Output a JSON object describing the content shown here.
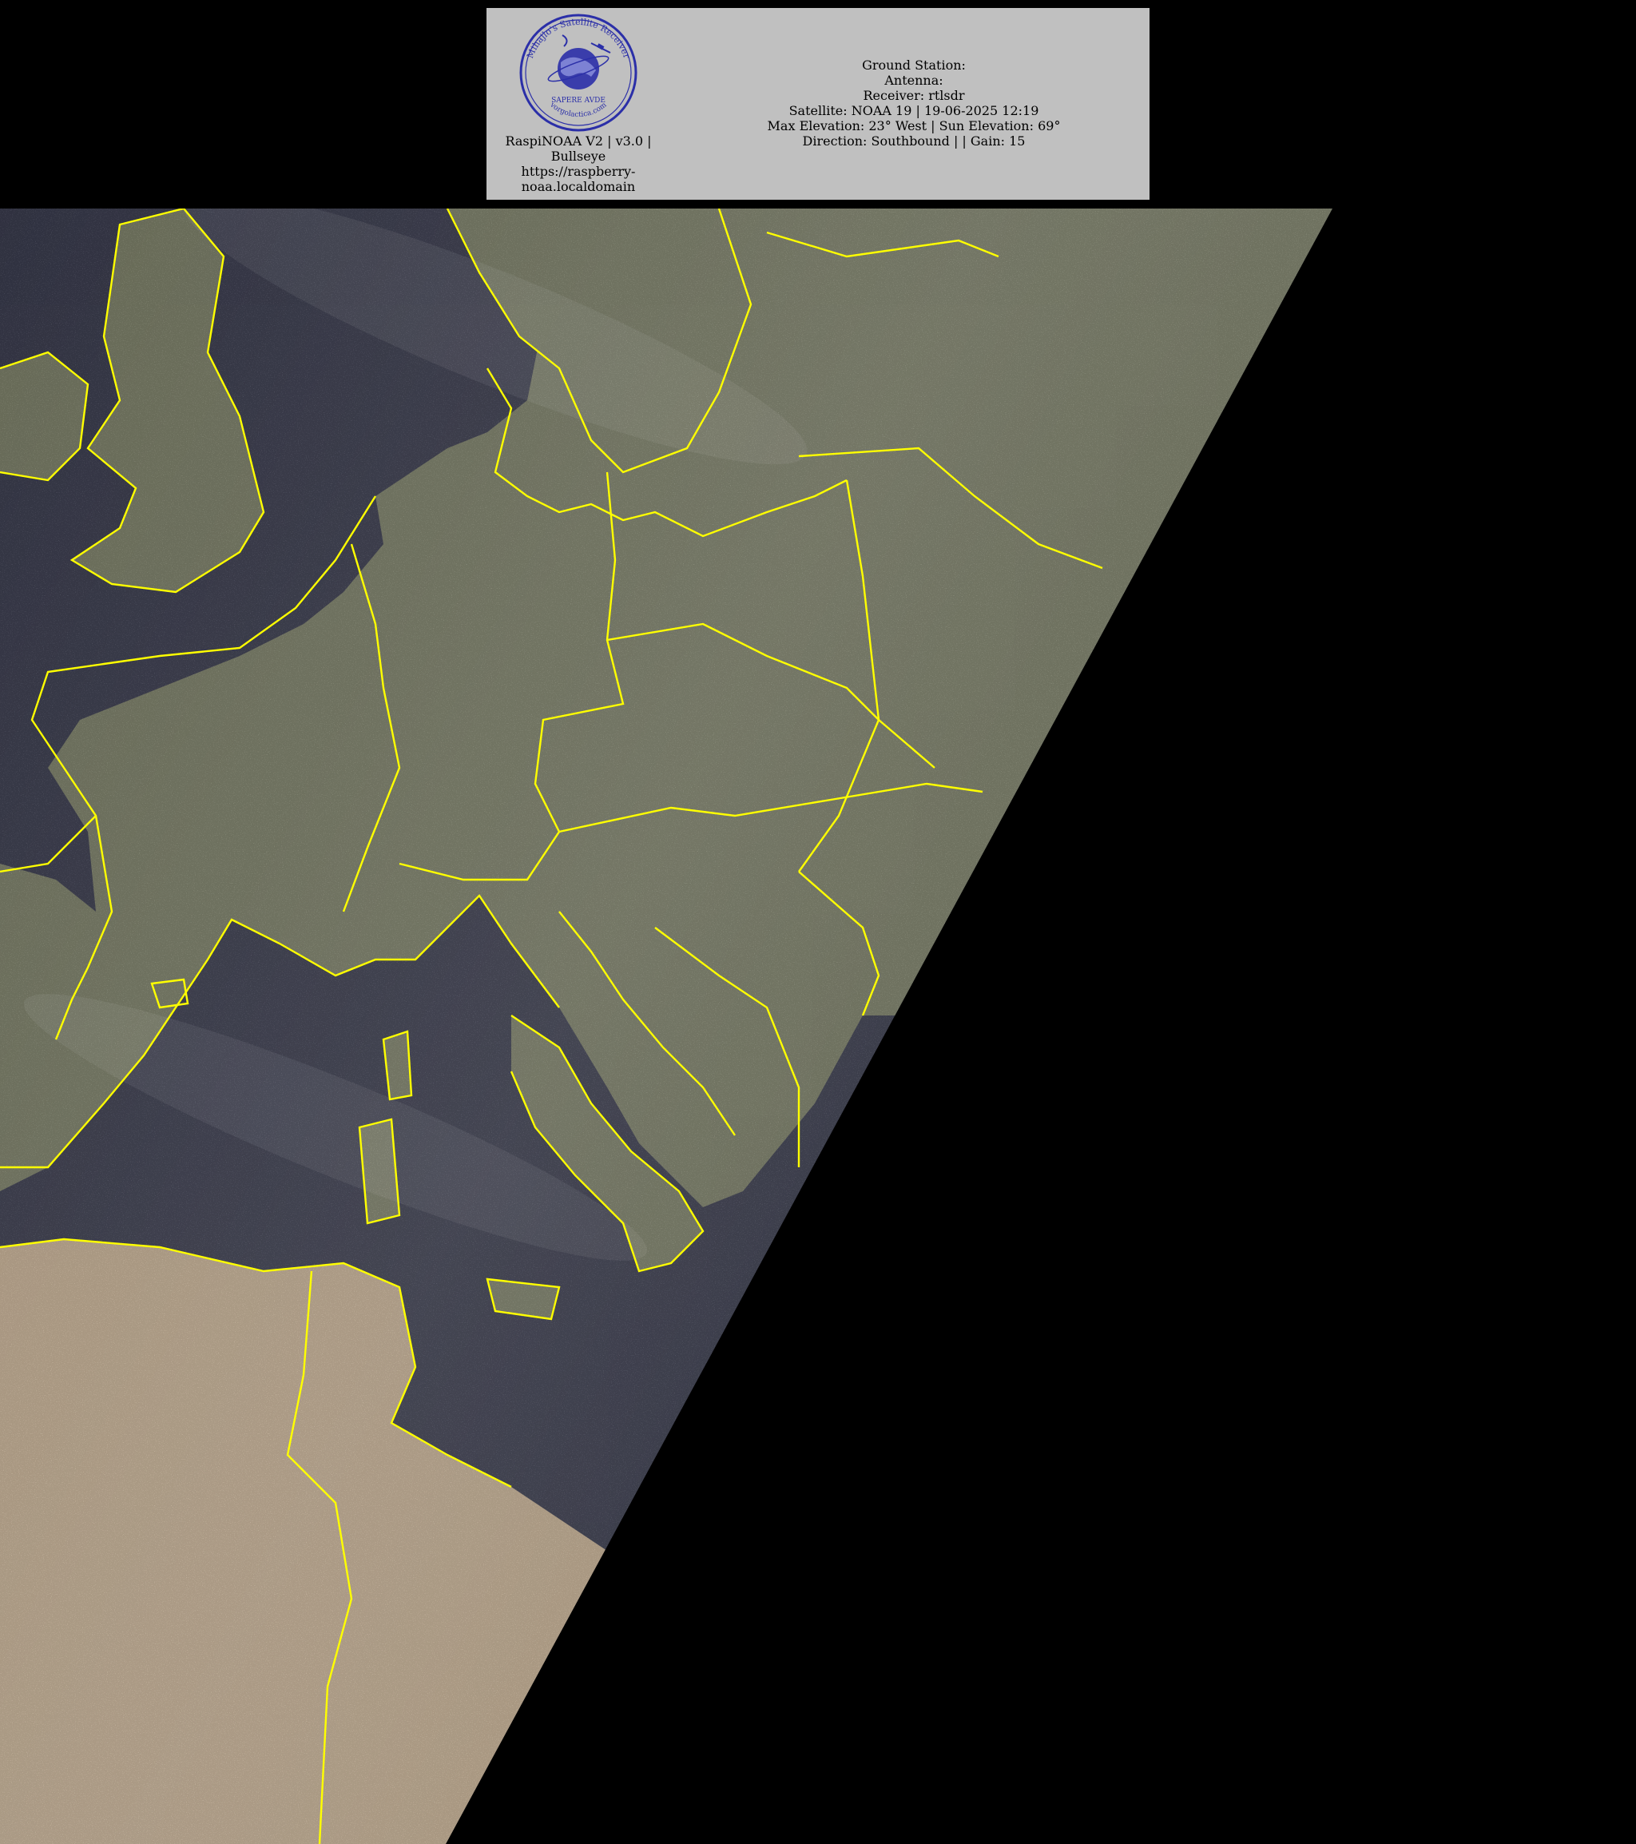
{
  "header": {
    "stamp": {
      "ring_text": "Mihajlo's Satellite Receiver",
      "motto": "SAPERE AVDE",
      "site": "vorgolactica.com",
      "ink_color": "#2b2fa8"
    },
    "system": {
      "line1": "RaspiNOAA V2 | v3.0 |",
      "line2": "Bullseye",
      "line3": "https://raspberry-",
      "line4": "noaa.localdomain"
    },
    "pass": {
      "ground_station": "Ground Station:",
      "antenna": "Antenna:",
      "receiver": "Receiver: rtlsdr",
      "satellite": "Satellite: NOAA 19 | 19-06-2025 12:19",
      "elevation": "Max Elevation: 23° West | Sun Elevation: 69°",
      "direction": "Direction: Southbound | | Gain: 15"
    },
    "panel_color": "#c0c0c0"
  },
  "image": {
    "subject": "satellite-pass",
    "border_color": "#ffff00",
    "colors": {
      "sea": "#14162a",
      "land_green": "#5e6248",
      "land_desert": "#b39a7a",
      "no_signal": "#000000"
    }
  }
}
